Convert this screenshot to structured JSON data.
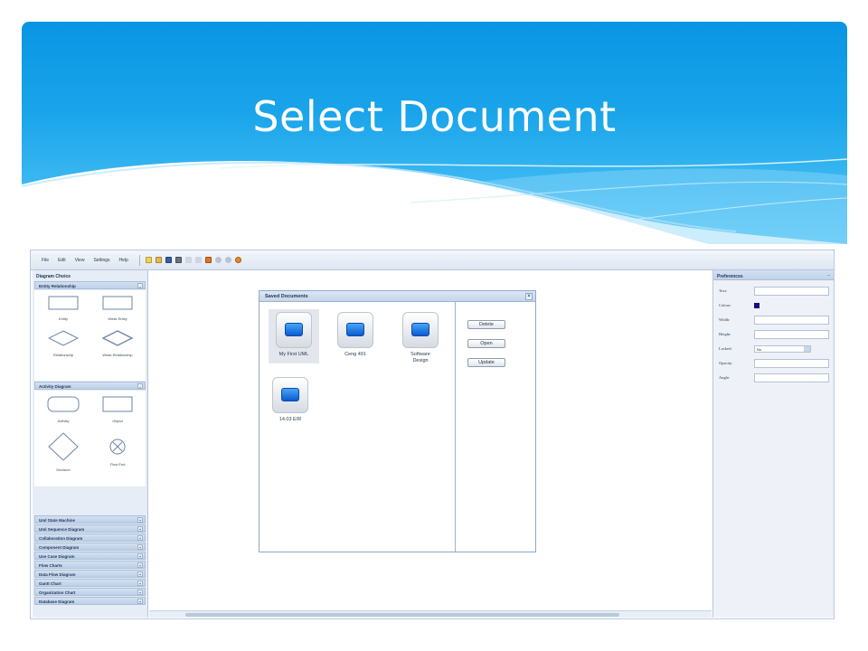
{
  "slide": {
    "title": "Select Document"
  },
  "menubar": {
    "items": [
      "File",
      "Edit",
      "View",
      "Settings",
      "Help"
    ],
    "tool_icons": [
      "new-icon",
      "open-icon",
      "save-icon",
      "print-icon",
      "undo-icon",
      "redo-icon",
      "cut-icon",
      "zoom-in-icon",
      "zoom-out-icon",
      "refresh-icon"
    ]
  },
  "left_panel": {
    "title": "Diagram Choice",
    "entity_section": {
      "header": "Entity Relationship",
      "shapes": [
        "Entity",
        "Weak Entity",
        "Relationship",
        "Weak Relationship"
      ]
    },
    "activity_section": {
      "header": "Activity Diagram",
      "shapes": [
        "Activity",
        "Object",
        "Decision",
        "Flow End"
      ]
    },
    "sections": [
      "Uml State Machine",
      "Uml Sequence Diagram",
      "Collaboration Diagram",
      "Component Diagram",
      "Use Case Diagram",
      "Flow Charts",
      "Data Flow Diagram",
      "Gantt Chart",
      "Organization Chart",
      "Database Diagram"
    ]
  },
  "dialog": {
    "title": "Saved Documents",
    "close": "×",
    "documents": [
      "My First UML",
      "Ceng 491",
      "Software Design",
      "14.03 E/R"
    ],
    "buttons": {
      "delete": "Delete",
      "open": "Open",
      "update": "Update"
    }
  },
  "right_panel": {
    "title": "Preferences",
    "fields": {
      "text": "Text:",
      "colour": "Colour:",
      "width": "Width:",
      "height": "Height:",
      "locked": "Locked:",
      "opacity": "Opacity:",
      "angle": "Angle:"
    },
    "locked_value": "No",
    "colour_value": "#1b0a7a"
  }
}
